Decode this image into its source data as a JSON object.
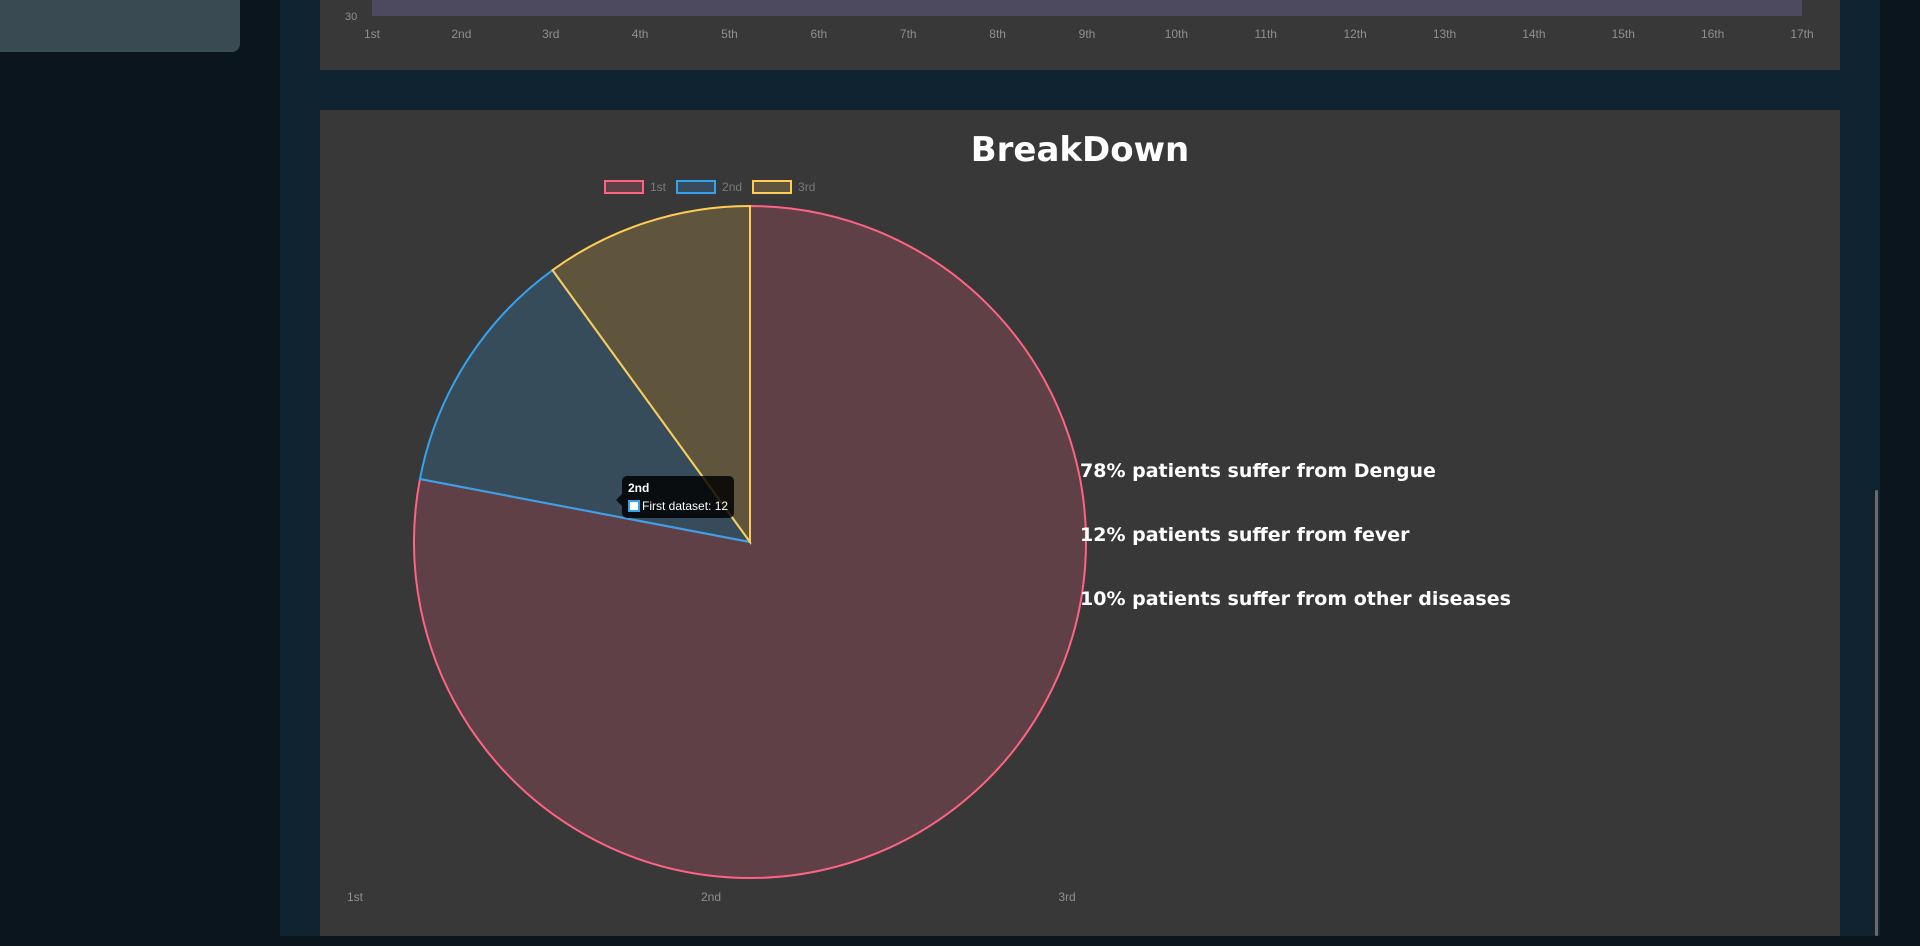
{
  "line_chart": {
    "y_tick": "30",
    "x_ticks": [
      "1st",
      "2nd",
      "3rd",
      "4th",
      "5th",
      "6th",
      "7th",
      "8th",
      "9th",
      "10th",
      "11th",
      "12th",
      "13th",
      "14th",
      "15th",
      "16th",
      "17th"
    ]
  },
  "breakdown": {
    "title": "BreakDown",
    "stats": [
      "78% patients suffer from Dengue",
      "12% patients suffer from fever",
      "10% patients suffer from other diseases"
    ],
    "tooltip": {
      "title": "2nd",
      "body": "First dataset: 12"
    }
  },
  "colors": {
    "first": "#ff6384",
    "second": "#36a2eb",
    "third": "#ffcd56",
    "card_bg": "#383838",
    "panel_bg": "#0f2331",
    "page_bg": "#0a151d"
  },
  "chart_data": {
    "type": "pie",
    "categories": [
      "1st",
      "2nd",
      "3rd"
    ],
    "series": [
      {
        "name": "First dataset",
        "values": [
          78,
          12,
          10
        ]
      }
    ],
    "title": "BreakDown",
    "legend": [
      "1st",
      "2nd",
      "3rd"
    ],
    "legend_position": "top",
    "x_tick_labels": [
      "1st",
      "2nd",
      "3rd"
    ]
  }
}
